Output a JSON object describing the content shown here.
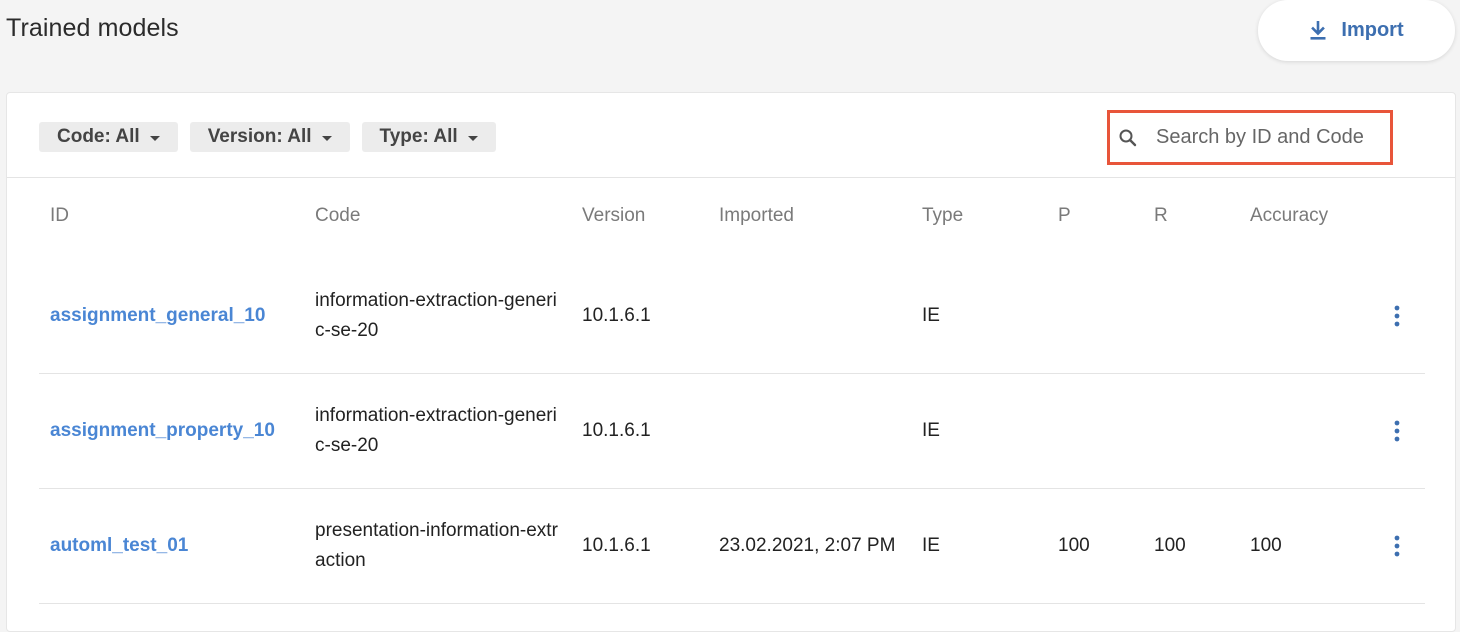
{
  "page": {
    "title": "Trained models",
    "import_label": "Import"
  },
  "filters": [
    {
      "label": "Code: All"
    },
    {
      "label": "Version: All"
    },
    {
      "label": "Type: All"
    }
  ],
  "search": {
    "placeholder": "Search by ID and Code",
    "value": ""
  },
  "table": {
    "columns": [
      "ID",
      "Code",
      "Version",
      "Imported",
      "Type",
      "P",
      "R",
      "Accuracy"
    ],
    "rows": [
      {
        "id": "assignment_general_10",
        "code": "information-extraction-generic-se-20",
        "version": "10.1.6.1",
        "imported": "",
        "type": "IE",
        "p": "",
        "r": "",
        "accuracy": ""
      },
      {
        "id": "assignment_property_10",
        "code": "information-extraction-generic-se-20",
        "version": "10.1.6.1",
        "imported": "",
        "type": "IE",
        "p": "",
        "r": "",
        "accuracy": ""
      },
      {
        "id": "automl_test_01",
        "code": "presentation-information-extraction",
        "version": "10.1.6.1",
        "imported": "23.02.2021, 2:07 PM",
        "type": "IE",
        "p": "100",
        "r": "100",
        "accuracy": "100"
      }
    ]
  },
  "colors": {
    "link": "#4a86d4",
    "accent": "#3d6fb0",
    "search_highlight": "#e8553a"
  },
  "icons": {
    "import": "download-icon",
    "search": "search-icon",
    "caret": "caret-down-icon",
    "row_menu": "more-vertical-icon"
  }
}
